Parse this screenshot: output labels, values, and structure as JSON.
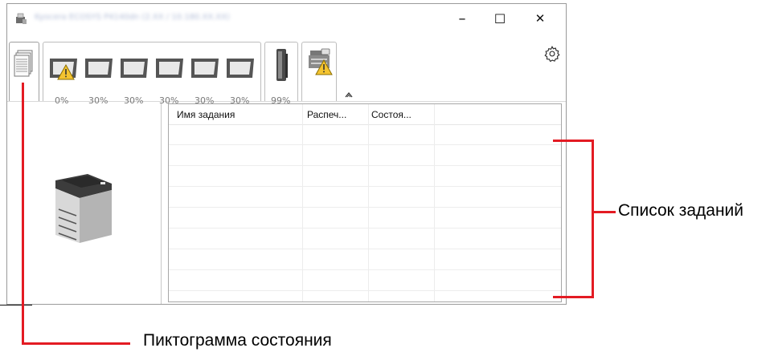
{
  "window": {
    "title": "Kyocera ECOSYS P4140dn (2.XX / 10.180.XX.XX)",
    "minimize": "–",
    "maximize": "☐",
    "close": "✕"
  },
  "toolbar": {
    "trays": [
      {
        "level": "0%",
        "warning": true
      },
      {
        "level": "30%",
        "warning": false
      },
      {
        "level": "30%",
        "warning": false
      },
      {
        "level": "30%",
        "warning": false
      },
      {
        "level": "30%",
        "warning": false
      },
      {
        "level": "30%",
        "warning": false
      }
    ],
    "toner": {
      "level": "99%"
    },
    "icons": {
      "status": "status-pages-icon",
      "device": "device-warning-icon",
      "settings": "gear-icon",
      "expand": "expand-up-icon"
    }
  },
  "job_list": {
    "columns": [
      "Имя задания",
      "Распеч...",
      "Состоя..."
    ]
  },
  "annotations": {
    "job_list_label": "Список заданий",
    "status_icon_label": "Пиктограмма состояния",
    "color": "#e31b23"
  }
}
